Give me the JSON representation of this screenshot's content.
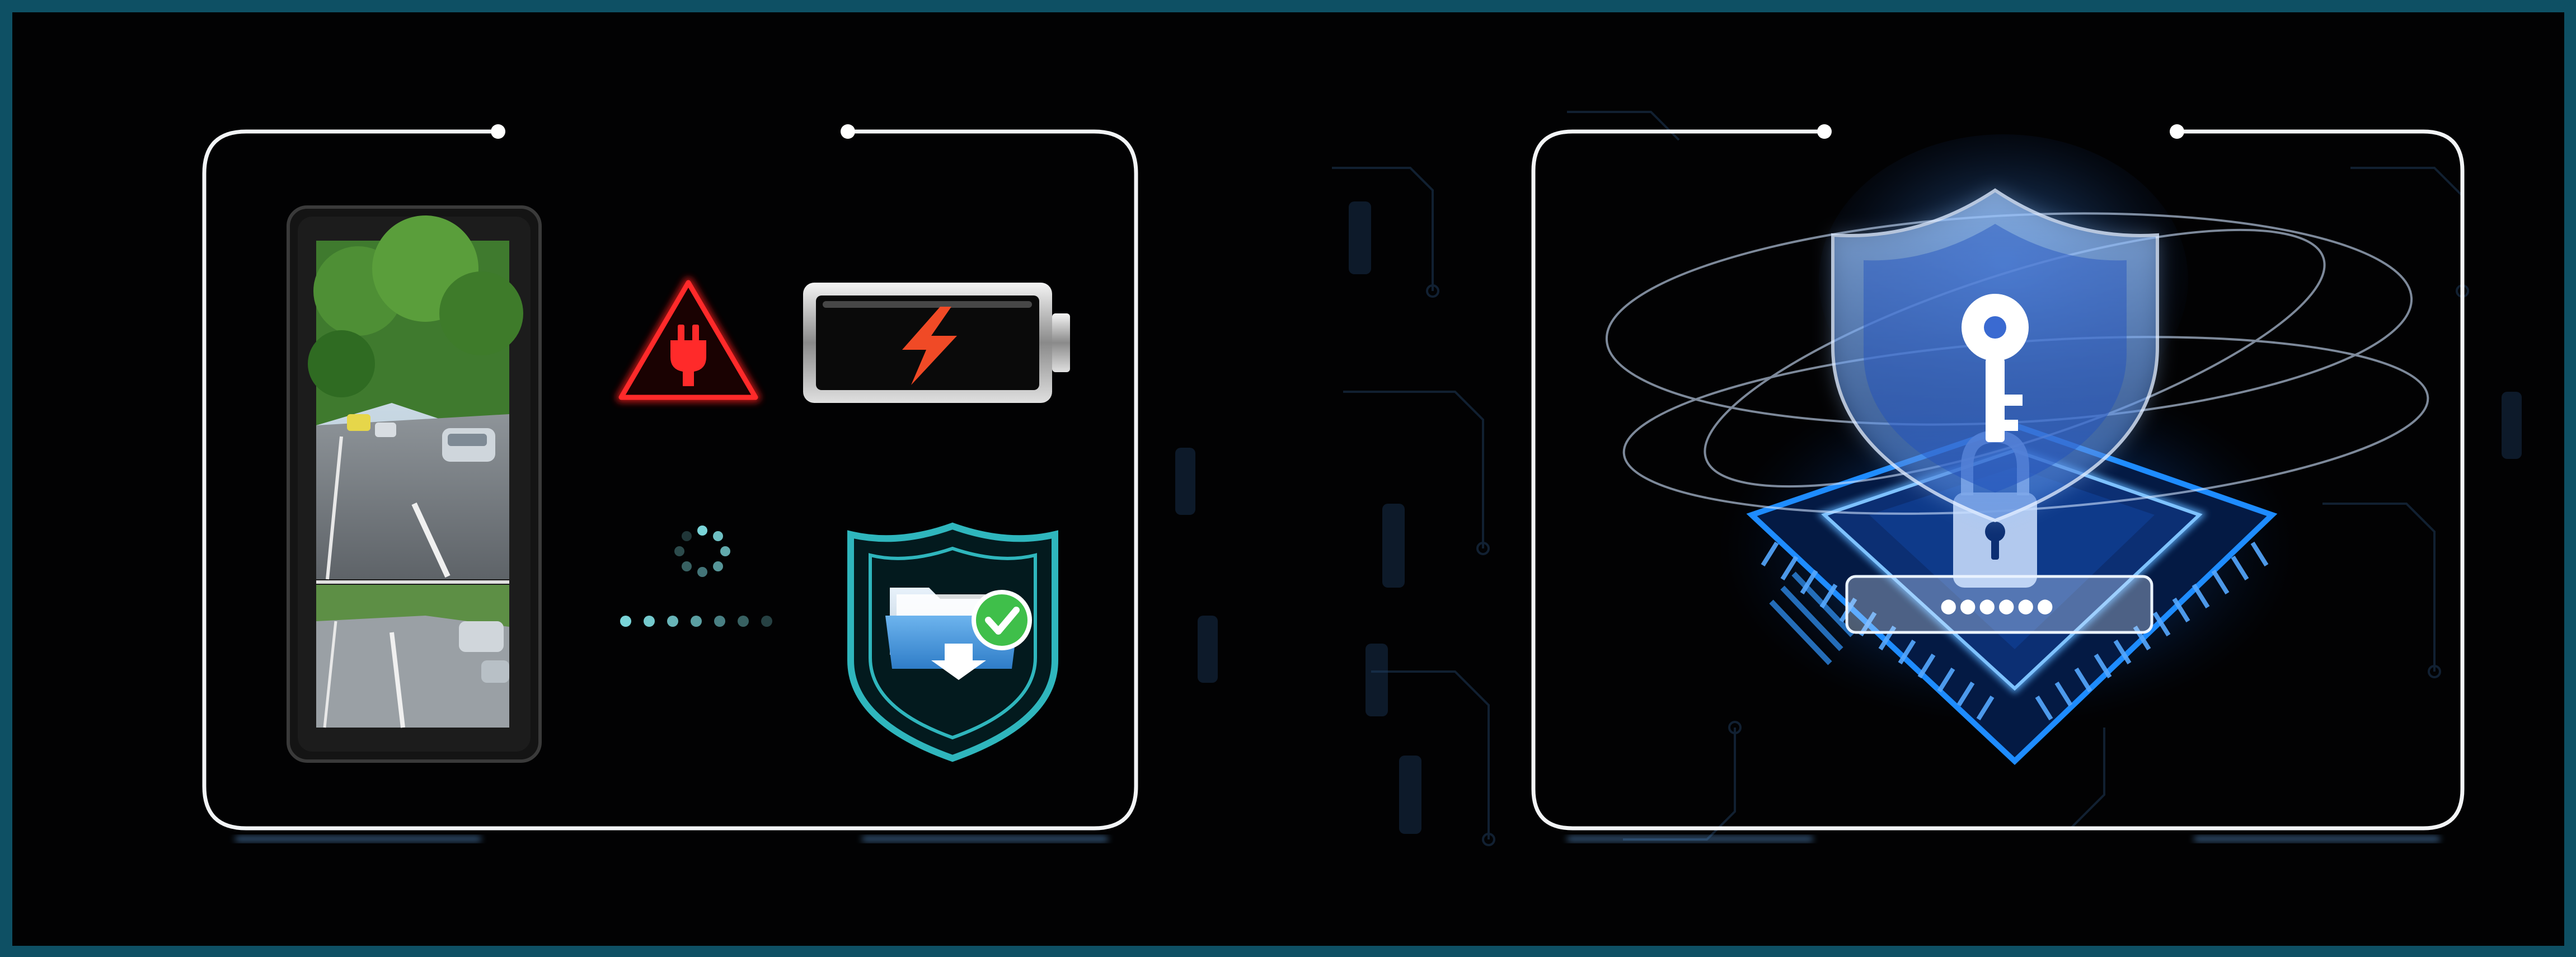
{
  "colors": {
    "frame_border": "#0e5064",
    "background": "#020203",
    "panel_outline": "#f2f4f6",
    "power_warning": "#ff1f1f",
    "battery_bolt": "#f04a26",
    "loading_dots": "#7ad4d8",
    "shield_outline": "#2fb6bd",
    "folder": "#4d9fe0",
    "check": "#3fbf4a",
    "hologram": "#4d9fff",
    "chip_glow": "#1e8cff"
  },
  "panels": {
    "features": {
      "mirror_display": {
        "icon": "rearview-mirror-monitor"
      },
      "power": {
        "icon": "power-plug-warning-icon"
      },
      "battery": {
        "icon": "battery-charging-icon"
      },
      "loading": {
        "icon": "loading-spinner-icon"
      },
      "secure_folder": {
        "icon": "shield-folder-check-icon"
      }
    },
    "security": {
      "shield": {
        "icon": "shield-key-icon"
      },
      "lock": {
        "icon": "padlock-icon"
      },
      "password_field": {
        "value": "●●●●●●"
      },
      "chip": {
        "icon": "microchip-icon"
      }
    }
  }
}
